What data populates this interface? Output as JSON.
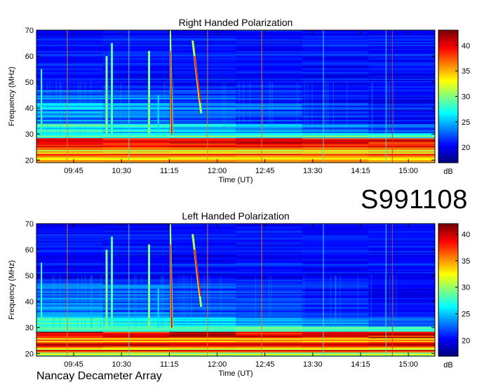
{
  "observation_id": "S991108",
  "instrument": "Nancay Decameter Array",
  "chart_data": [
    {
      "type": "heatmap",
      "title": "Right Handed Polarization",
      "xlabel": "Time (UT)",
      "ylabel": "Frequency (MHz)",
      "x_ticks": [
        "09:45",
        "10:30",
        "11:15",
        "12:00",
        "12:45",
        "13:30",
        "14:15",
        "15:00"
      ],
      "y_ticks": [
        20,
        30,
        40,
        50,
        60,
        70
      ],
      "ylim": [
        19,
        70
      ],
      "colorbar": {
        "label": "dB",
        "ticks": [
          20,
          25,
          30,
          35,
          40
        ],
        "range": [
          17,
          43
        ]
      },
      "features": {
        "type_iii_bursts_ut": [
          "09:25",
          "10:20",
          "10:55",
          "11:16",
          "11:40"
        ],
        "strong_interference_band_mhz": [
          21,
          28
        ]
      }
    },
    {
      "type": "heatmap",
      "title": "Left Handed Polarization",
      "xlabel": "Time (UT)",
      "ylabel": "Frequency (MHz)",
      "x_ticks": [
        "09:45",
        "10:30",
        "11:15",
        "12:00",
        "12:45",
        "13:30",
        "14:15",
        "15:00"
      ],
      "y_ticks": [
        20,
        30,
        40,
        50,
        60,
        70
      ],
      "ylim": [
        19,
        70
      ],
      "colorbar": {
        "label": "dB",
        "ticks": [
          20,
          25,
          30,
          35,
          40
        ],
        "range": [
          17,
          42
        ]
      },
      "features": {
        "type_iii_bursts_ut": [
          "09:25",
          "10:20",
          "10:55",
          "11:16",
          "11:40"
        ],
        "strong_interference_band_mhz": [
          21,
          28
        ]
      }
    }
  ]
}
